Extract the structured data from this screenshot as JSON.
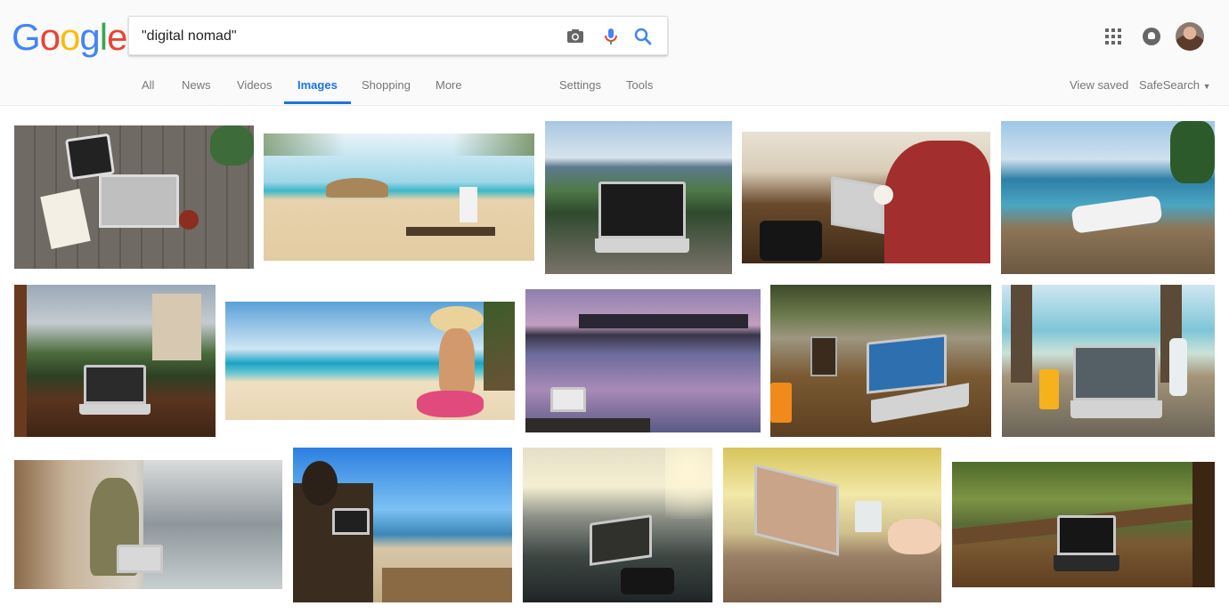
{
  "logo": {
    "letters": [
      "G",
      "o",
      "o",
      "g",
      "l",
      "e"
    ],
    "colors": [
      "#4285F4",
      "#EA4335",
      "#FBBC05",
      "#4285F4",
      "#34A853",
      "#EA4335"
    ]
  },
  "search": {
    "query": "\"digital nomad\""
  },
  "icons": {
    "camera": "camera-icon",
    "mic": "mic-icon",
    "search": "search-icon",
    "apps": "apps-grid-icon",
    "notifications": "notifications-icon"
  },
  "tabs": [
    {
      "label": "All",
      "active": false
    },
    {
      "label": "News",
      "active": false
    },
    {
      "label": "Videos",
      "active": false
    },
    {
      "label": "Images",
      "active": true
    },
    {
      "label": "Shopping",
      "active": false
    },
    {
      "label": "More",
      "active": false
    },
    {
      "label": "Settings",
      "active": false
    },
    {
      "label": "Tools",
      "active": false
    }
  ],
  "right_links": {
    "view_saved": "View saved",
    "safesearch": "SafeSearch"
  },
  "colors": {
    "accent": "#1a73e8",
    "tab_text": "#777777",
    "header_bg": "#fafafa"
  },
  "results": {
    "rows": [
      [
        {
          "subject": "laptop-on-wooden-deck-top-view"
        },
        {
          "subject": "beach-hut-and-laptop-on-sand"
        },
        {
          "subject": "laptop-on-terrace-mountain-view"
        },
        {
          "subject": "man-with-laptop-in-cafe"
        },
        {
          "subject": "woman-on-lounger-by-sea"
        }
      ],
      [
        {
          "subject": "laptop-on-window-sill-mountains"
        },
        {
          "subject": "woman-in-sunhat-on-beach"
        },
        {
          "subject": "laptop-on-jetty-at-sunset"
        },
        {
          "subject": "laptop-on-cafe-table-with-juice"
        },
        {
          "subject": "laptop-on-beach-table-with-drink"
        }
      ],
      [
        {
          "subject": "woman-working-by-window-sea"
        },
        {
          "subject": "man-on-beach-chair-with-laptop"
        },
        {
          "subject": "laptop-on-balcony-sunset"
        },
        {
          "subject": "laptop-in-sunny-garden"
        },
        {
          "subject": "laptop-on-jungle-balcony"
        }
      ]
    ]
  }
}
